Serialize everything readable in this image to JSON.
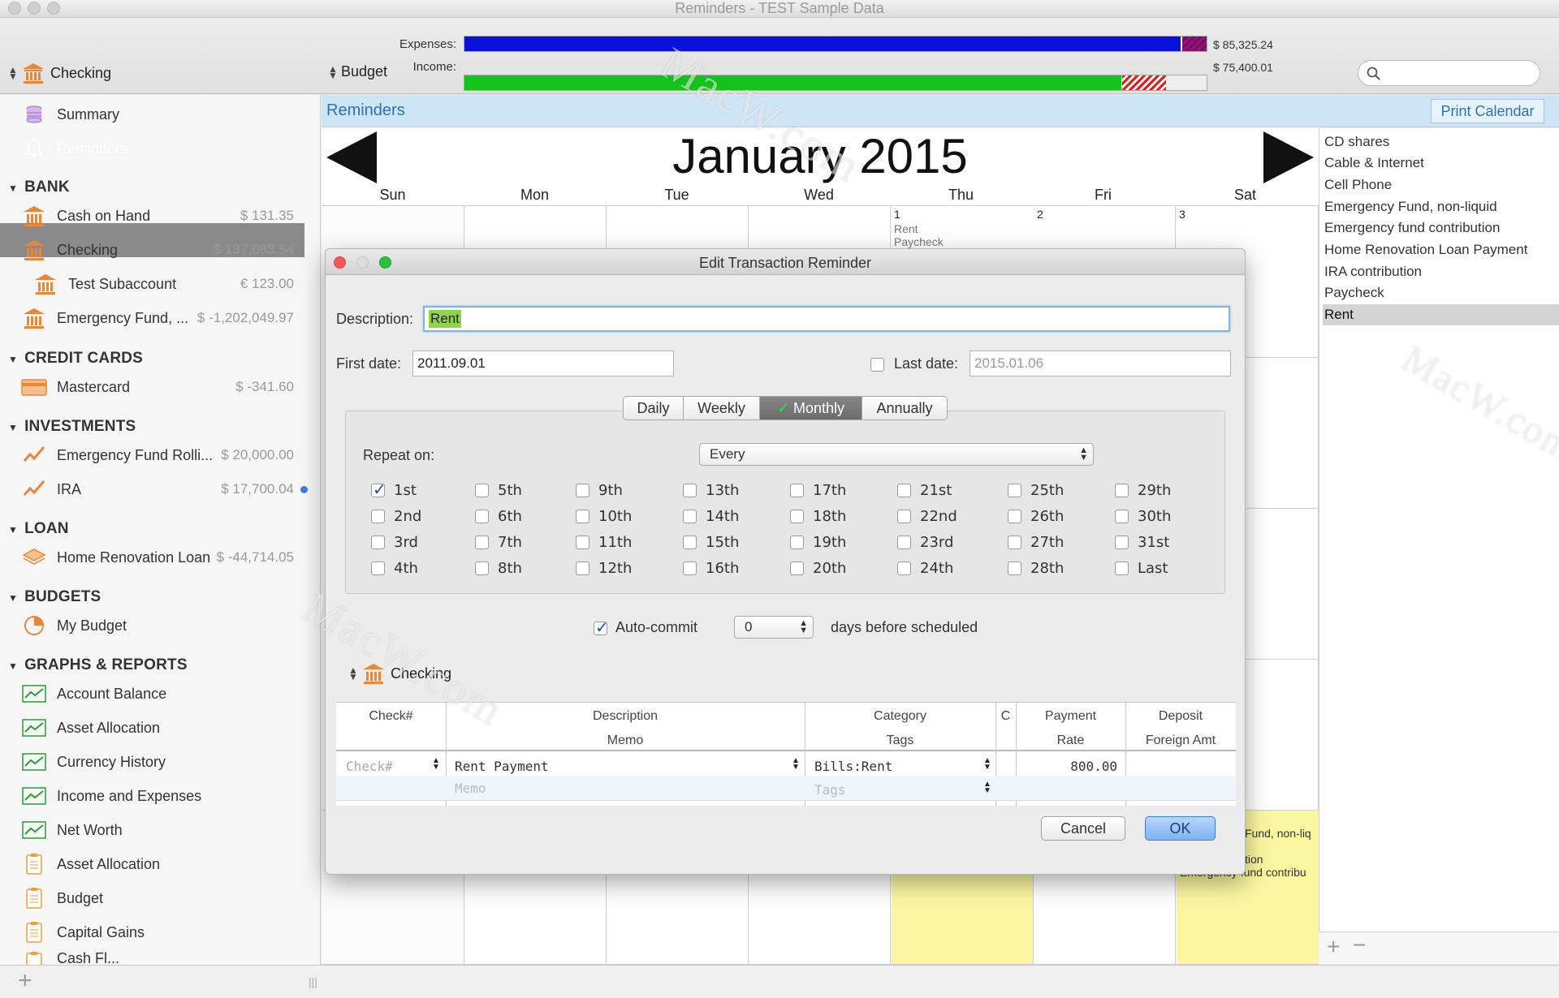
{
  "window": {
    "title": "Reminders - TEST Sample Data"
  },
  "toolbar": {
    "account": "Checking",
    "budget": "Budget",
    "expenses_label": "Expenses:",
    "income_label": "Income:",
    "expenses_amount": "$ 85,325.24",
    "income_amount": "$ 75,400.01",
    "expenses_fill": 0.965,
    "income_fill": 0.885,
    "search_placeholder": ""
  },
  "sidebar": {
    "top": [
      {
        "label": "Summary"
      },
      {
        "label": "Reminders"
      }
    ],
    "sections": {
      "bank": "BANK",
      "credit_cards": "CREDIT CARDS",
      "investments": "INVESTMENTS",
      "loan": "LOAN",
      "budgets": "BUDGETS",
      "graphs": "GRAPHS & REPORTS"
    },
    "bank": [
      {
        "label": "Cash on Hand",
        "amount": "$ 131.35"
      },
      {
        "label": "Checking",
        "amount": "$ 137,083.54"
      },
      {
        "label": "Test Subaccount",
        "amount": "€ 123.00"
      },
      {
        "label": "Emergency Fund, ...",
        "amount": "$ -1,202,049.97"
      }
    ],
    "credit_cards": [
      {
        "label": "Mastercard",
        "amount": "$ -341.60"
      }
    ],
    "investments": [
      {
        "label": "Emergency Fund Rolli...",
        "amount": "$ 20,000.00"
      },
      {
        "label": "IRA",
        "amount": "$ 17,700.04"
      }
    ],
    "loan": [
      {
        "label": "Home Renovation Loan",
        "amount": "$ -44,714.05"
      }
    ],
    "budgets": [
      {
        "label": "My Budget"
      }
    ],
    "graphs": [
      {
        "label": "Account Balance"
      },
      {
        "label": "Asset Allocation"
      },
      {
        "label": "Currency History"
      },
      {
        "label": "Income and Expenses"
      },
      {
        "label": "Net Worth"
      },
      {
        "label": "Asset Allocation"
      },
      {
        "label": "Budget"
      },
      {
        "label": "Capital Gains"
      },
      {
        "label": "Cash Fl..."
      }
    ]
  },
  "reminders": {
    "header": "Reminders",
    "print_button": "Print Calendar",
    "month": "January 2015",
    "days_of_week": [
      "Sun",
      "Mon",
      "Tue",
      "Wed",
      "Thu",
      "Fri",
      "Sat"
    ],
    "first_week": [
      {
        "day": "1",
        "events": [
          "Rent",
          "Paycheck"
        ]
      },
      {
        "day": "2",
        "events": []
      },
      {
        "day": "3",
        "events": []
      }
    ],
    "partial_events": [
      "Fund, non-liq",
      "tion",
      "Emergency fund contribu"
    ],
    "list": [
      "CD shares",
      "Cable & Internet",
      "Cell Phone",
      "Emergency Fund, non-liquid",
      "Emergency fund contribution",
      "Home Renovation Loan Payment",
      "IRA contribution",
      "Paycheck",
      "Rent"
    ],
    "selected_item": "Rent"
  },
  "dialog": {
    "title": "Edit Transaction Reminder",
    "description_label": "Description:",
    "description_value": "Rent",
    "first_date_label": "First date:",
    "first_date_value": "2011.09.01",
    "last_date_label": "Last date:",
    "last_date_value": "2015.01.06",
    "last_date_checked": false,
    "tabs": [
      "Daily",
      "Weekly",
      "Monthly",
      "Annually"
    ],
    "selected_tab": "Monthly",
    "repeat_on_label": "Repeat on:",
    "repeat_on_value": "Every",
    "days": [
      [
        "1st",
        "5th",
        "9th",
        "13th",
        "17th",
        "21st",
        "25th",
        "29th"
      ],
      [
        "2nd",
        "6th",
        "10th",
        "14th",
        "18th",
        "22nd",
        "26th",
        "30th"
      ],
      [
        "3rd",
        "7th",
        "11th",
        "15th",
        "19th",
        "23rd",
        "27th",
        "31st"
      ],
      [
        "4th",
        "8th",
        "12th",
        "16th",
        "20th",
        "24th",
        "28th",
        "Last"
      ]
    ],
    "checked_days": [
      "1st"
    ],
    "autocommit_label": "Auto-commit",
    "autocommit_checked": true,
    "autocommit_days": "0",
    "days_before_label": "days before scheduled",
    "account": "Checking",
    "table": {
      "headers_top": [
        "Check#",
        "Description",
        "Category",
        "C",
        "Payment",
        "Deposit"
      ],
      "headers_bottom": [
        "",
        "Memo",
        "Tags",
        "",
        "Rate",
        "Foreign Amt"
      ],
      "row": {
        "check_placeholder": "Check#",
        "description": "Rent Payment",
        "category": "Bills:Rent",
        "payment": "800.00",
        "memo_placeholder": "Memo",
        "tags_placeholder": "Tags"
      }
    },
    "cancel": "Cancel",
    "ok": "OK"
  },
  "watermark": "MacW.com",
  "colors": {
    "expenses": "#0a12d8",
    "income": "#12c31a",
    "accent": "#2c72b5",
    "selected": "#8a8a8a"
  }
}
